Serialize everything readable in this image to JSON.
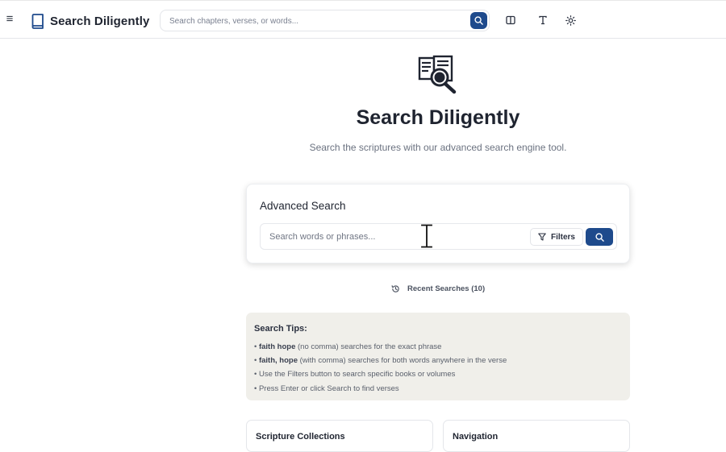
{
  "header": {
    "brand_title": "Search Diligently",
    "search_placeholder": "Search chapters, verses, or words..."
  },
  "hero": {
    "title": "Search Diligently",
    "subtitle": "Search the scriptures with our advanced search engine tool."
  },
  "advanced_search": {
    "title": "Advanced Search",
    "placeholder": "Search words or phrases...",
    "filters_label": "Filters"
  },
  "recent": {
    "label": "Recent Searches (10)"
  },
  "tips": {
    "title": "Search Tips:",
    "items": [
      {
        "bullet": "• ",
        "bold": "faith hope",
        "text": " (no comma) searches for the exact phrase"
      },
      {
        "bullet": "• ",
        "bold": "faith, hope",
        "text": " (with comma) searches for both words anywhere in the verse"
      },
      {
        "bullet": "• ",
        "bold": "",
        "text": "Use the Filters button to search specific books or volumes"
      },
      {
        "bullet": "• ",
        "bold": "",
        "text": "Press Enter or click Search to find verses"
      }
    ]
  },
  "cards": {
    "collections_title": "Scripture Collections",
    "navigation_title": "Navigation"
  },
  "colors": {
    "accent": "#1e4a8c",
    "tips_bg": "#f0efea"
  },
  "icons": {
    "menu": "hamburger-icon",
    "brand": "book-icon",
    "top_search": "search-icon",
    "layout": "columns-icon",
    "font": "text-size-icon",
    "theme": "sun-icon",
    "hero": "document-search-icon",
    "filters": "filter-icon",
    "recent": "history-icon"
  }
}
